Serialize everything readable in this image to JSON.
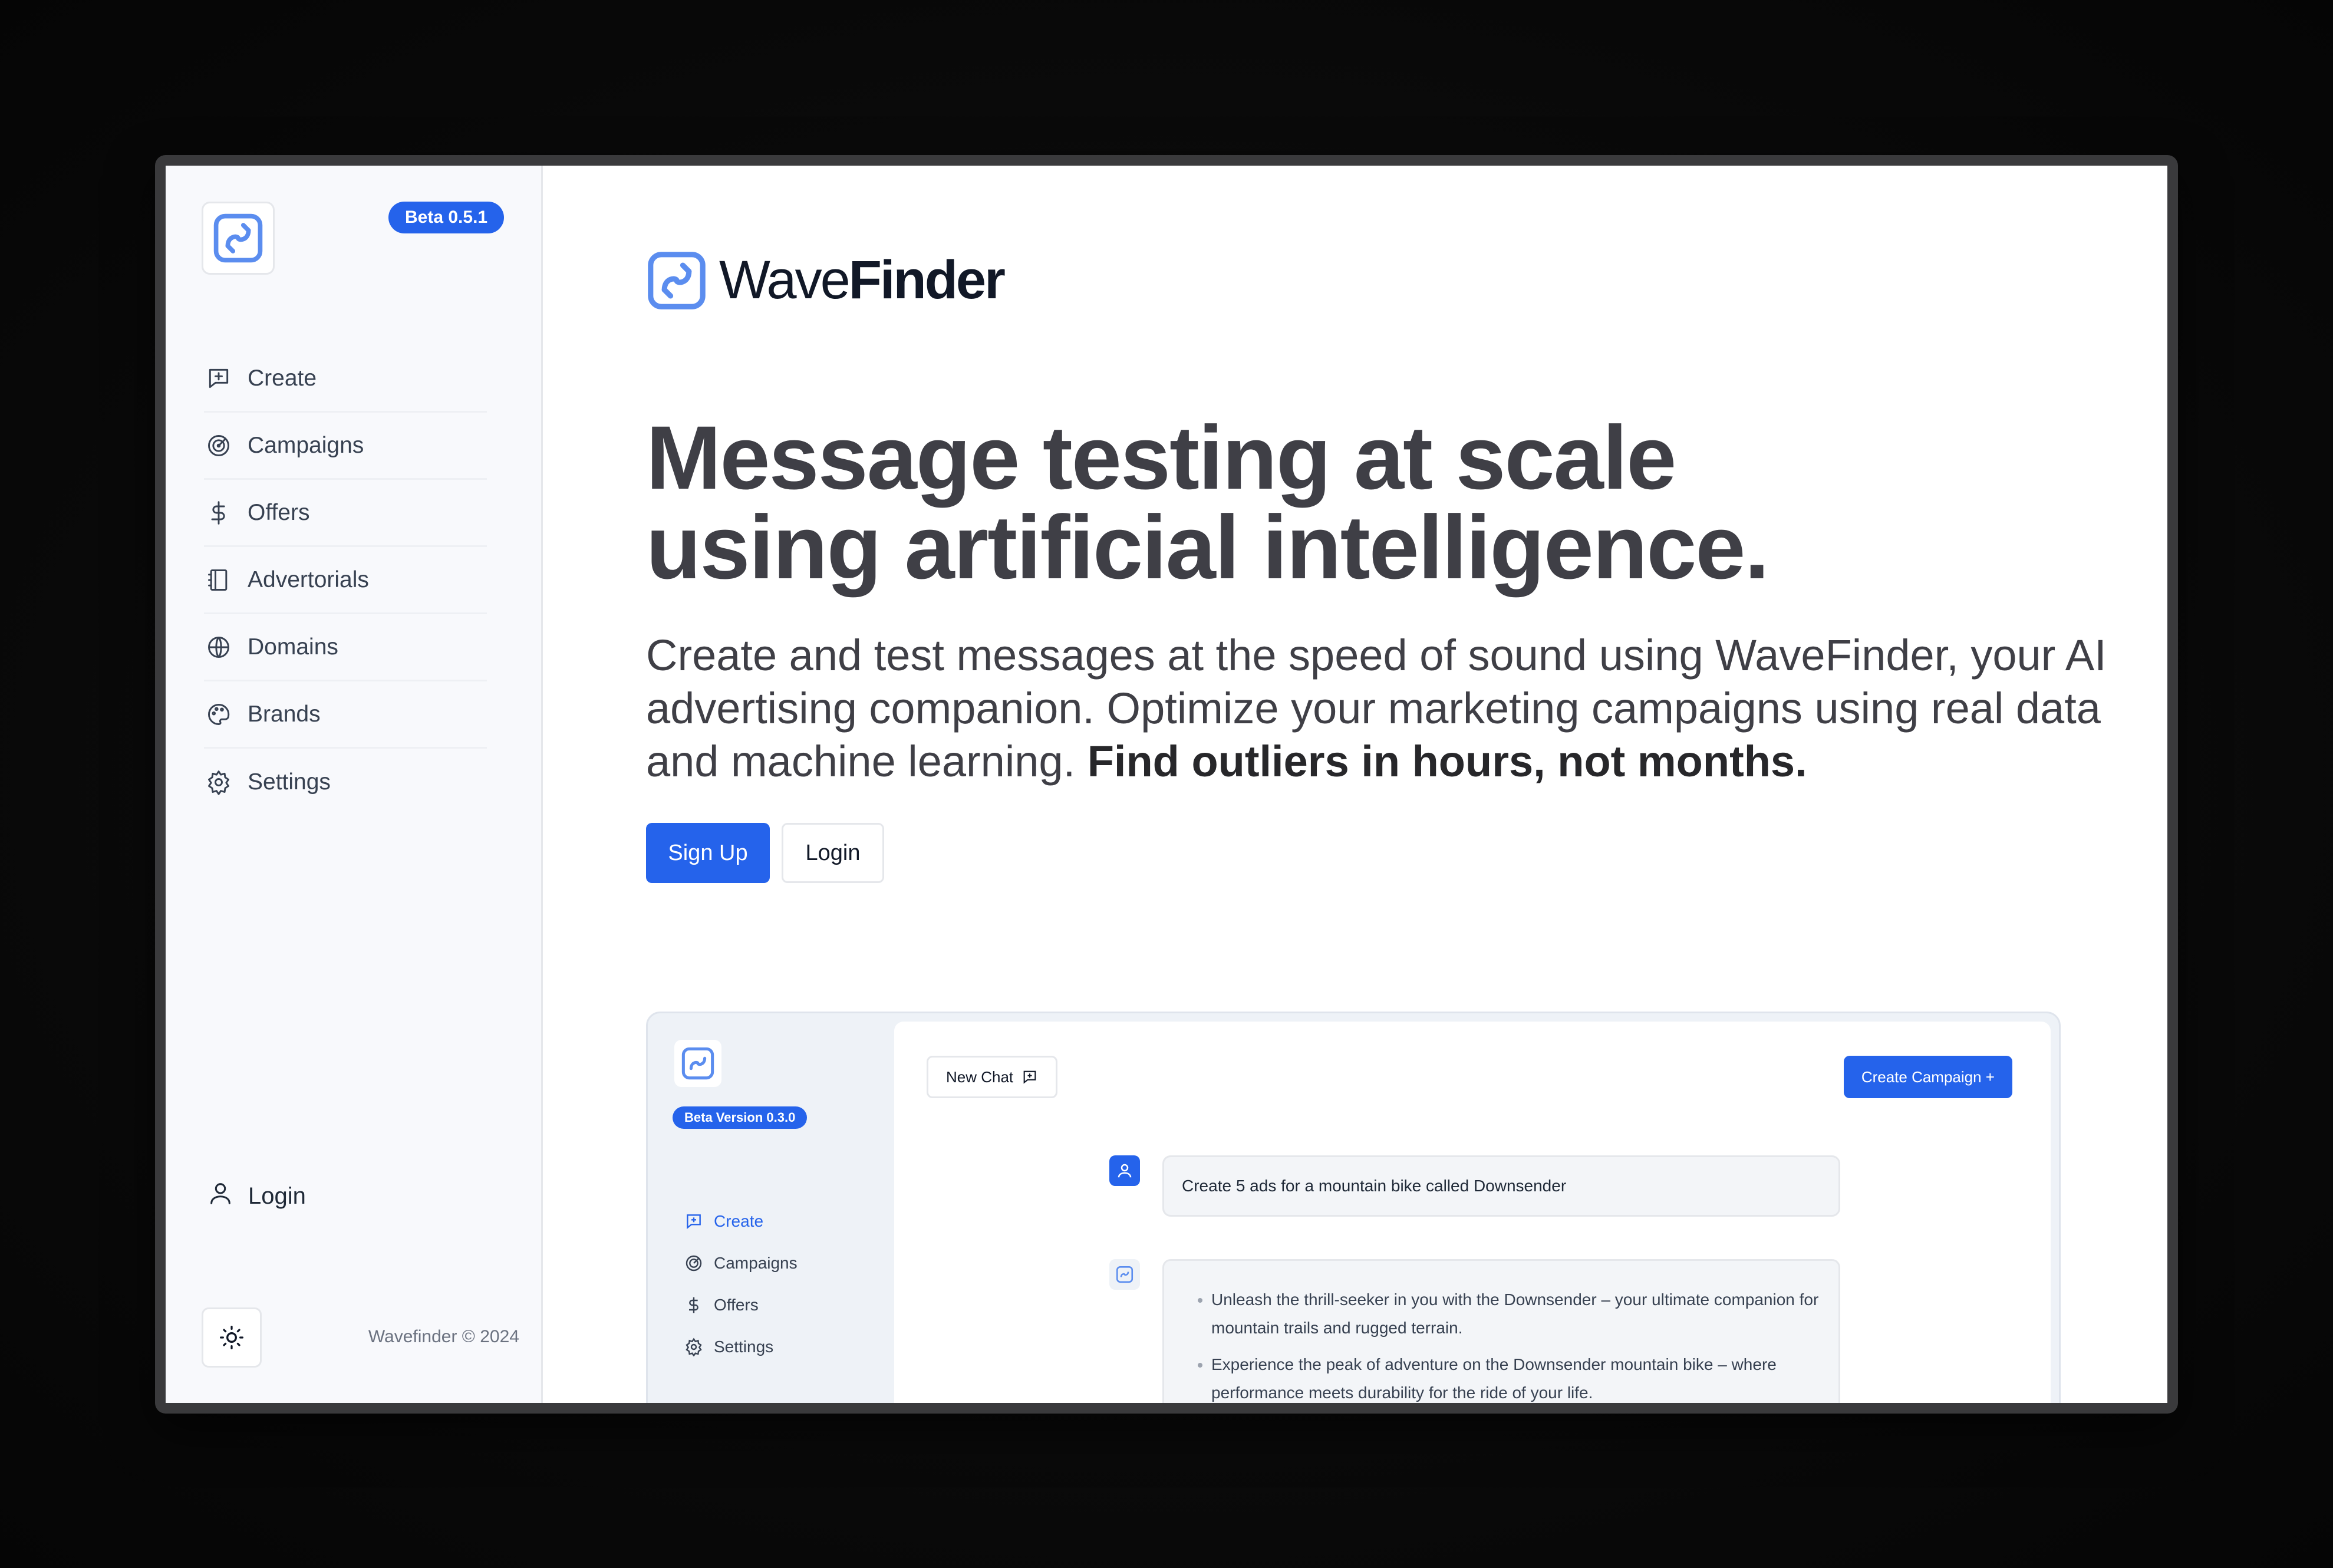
{
  "sidebar": {
    "beta_label": "Beta 0.5.1",
    "nav": [
      {
        "label": "Create",
        "icon": "message-plus-icon"
      },
      {
        "label": "Campaigns",
        "icon": "target-icon"
      },
      {
        "label": "Offers",
        "icon": "dollar-icon"
      },
      {
        "label": "Advertorials",
        "icon": "notebook-icon"
      },
      {
        "label": "Domains",
        "icon": "globe-icon"
      },
      {
        "label": "Brands",
        "icon": "palette-icon"
      },
      {
        "label": "Settings",
        "icon": "gear-icon"
      }
    ],
    "login_label": "Login",
    "copyright": "Wavefinder © 2024"
  },
  "main": {
    "brand_light": "Wave",
    "brand_bold": "Finder",
    "title_line1": "Message testing at scale",
    "title_line2": "using artificial intelligence.",
    "subtitle": "Create and test messages at the speed of sound using WaveFinder, your AI advertising companion. Optimize your marketing campaigns using real data and machine learning.",
    "subtitle_bold": "Find outliers in hours, not months.",
    "signup_label": "Sign Up",
    "login_label": "Login"
  },
  "preview": {
    "beta_label": "Beta Version 0.3.0",
    "nav": [
      {
        "label": "Create",
        "active": true
      },
      {
        "label": "Campaigns",
        "active": false
      },
      {
        "label": "Offers",
        "active": false
      },
      {
        "label": "Settings",
        "active": false
      }
    ],
    "new_chat_label": "New Chat",
    "create_campaign_label": "Create Campaign +",
    "user_message": "Create 5 ads for a mountain bike called Downsender",
    "response_items": [
      "Unleash the thrill-seeker in you with the Downsender – your ultimate companion for mountain trails and rugged terrain.",
      "Experience the peak of adventure on the Downsender mountain bike – where performance meets durability for the ride of your life."
    ]
  },
  "colors": {
    "accent": "#2563eb",
    "sidebar_bg": "#f8f9fc",
    "text": "#3f3f46"
  }
}
